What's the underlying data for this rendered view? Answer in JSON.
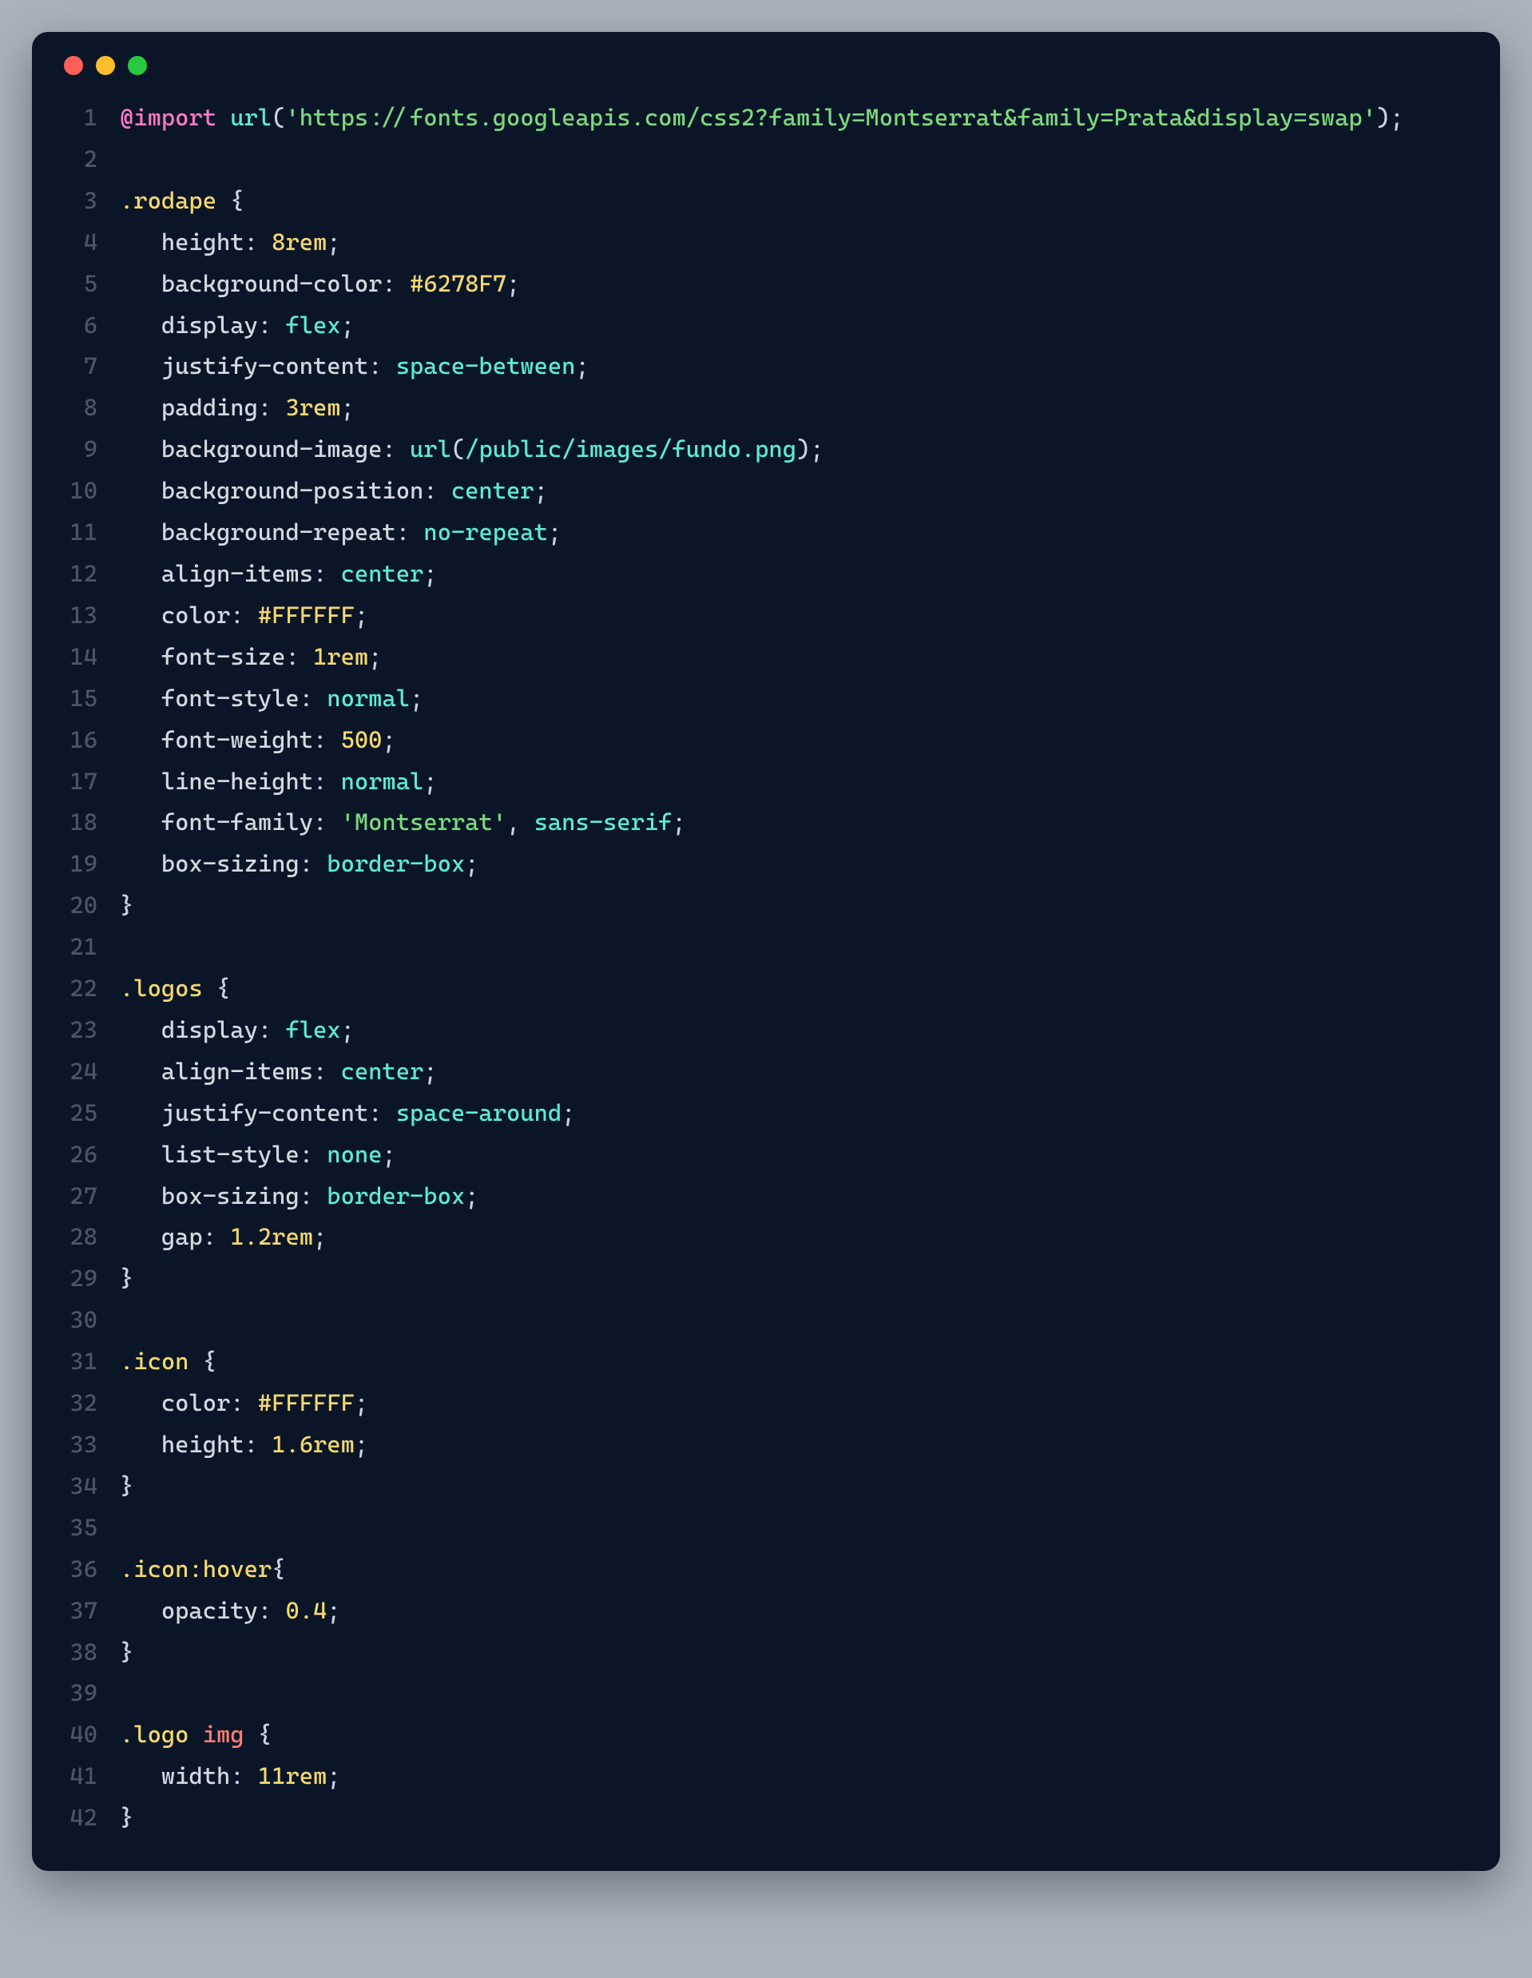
{
  "window": {
    "traffic_lights": [
      "red",
      "yellow",
      "green"
    ]
  },
  "code": {
    "lines": [
      {
        "n": 1,
        "t": [
          [
            "keyword",
            "@import"
          ],
          [
            "punc",
            " "
          ],
          [
            "func",
            "url"
          ],
          [
            "punc",
            "("
          ],
          [
            "string",
            "'https://fonts.googleapis.com/css2?family=Montserrat&family=Prata&display=swap'"
          ],
          [
            "punc",
            ");"
          ]
        ]
      },
      {
        "n": 2,
        "t": []
      },
      {
        "n": 3,
        "t": [
          [
            "selector",
            ".rodape"
          ],
          [
            "punc",
            " {"
          ]
        ]
      },
      {
        "n": 4,
        "t": [
          [
            "default",
            "   "
          ],
          [
            "prop",
            "height"
          ],
          [
            "punc",
            ": "
          ],
          [
            "number",
            "8rem"
          ],
          [
            "punc",
            ";"
          ]
        ]
      },
      {
        "n": 5,
        "t": [
          [
            "default",
            "   "
          ],
          [
            "prop",
            "background-color"
          ],
          [
            "punc",
            ": "
          ],
          [
            "number",
            "#6278F7"
          ],
          [
            "punc",
            ";"
          ]
        ]
      },
      {
        "n": 6,
        "t": [
          [
            "default",
            "   "
          ],
          [
            "prop",
            "display"
          ],
          [
            "punc",
            ": "
          ],
          [
            "value",
            "flex"
          ],
          [
            "punc",
            ";"
          ]
        ]
      },
      {
        "n": 7,
        "t": [
          [
            "default",
            "   "
          ],
          [
            "prop",
            "justify-content"
          ],
          [
            "punc",
            ": "
          ],
          [
            "value",
            "space-between"
          ],
          [
            "punc",
            ";"
          ]
        ]
      },
      {
        "n": 8,
        "t": [
          [
            "default",
            "   "
          ],
          [
            "prop",
            "padding"
          ],
          [
            "punc",
            ": "
          ],
          [
            "number",
            "3rem"
          ],
          [
            "punc",
            ";"
          ]
        ]
      },
      {
        "n": 9,
        "t": [
          [
            "default",
            "   "
          ],
          [
            "prop",
            "background-image"
          ],
          [
            "punc",
            ": "
          ],
          [
            "func",
            "url"
          ],
          [
            "punc",
            "("
          ],
          [
            "value",
            "/public/images/fundo.png"
          ],
          [
            "punc",
            ");"
          ]
        ]
      },
      {
        "n": 10,
        "t": [
          [
            "default",
            "   "
          ],
          [
            "prop",
            "background-position"
          ],
          [
            "punc",
            ": "
          ],
          [
            "value",
            "center"
          ],
          [
            "punc",
            ";"
          ]
        ]
      },
      {
        "n": 11,
        "t": [
          [
            "default",
            "   "
          ],
          [
            "prop",
            "background-repeat"
          ],
          [
            "punc",
            ": "
          ],
          [
            "value",
            "no-repeat"
          ],
          [
            "punc",
            ";"
          ]
        ]
      },
      {
        "n": 12,
        "t": [
          [
            "default",
            "   "
          ],
          [
            "prop",
            "align-items"
          ],
          [
            "punc",
            ": "
          ],
          [
            "value",
            "center"
          ],
          [
            "punc",
            ";"
          ]
        ]
      },
      {
        "n": 13,
        "t": [
          [
            "default",
            "   "
          ],
          [
            "prop",
            "color"
          ],
          [
            "punc",
            ": "
          ],
          [
            "number",
            "#FFFFFF"
          ],
          [
            "punc",
            ";"
          ]
        ]
      },
      {
        "n": 14,
        "t": [
          [
            "default",
            "   "
          ],
          [
            "prop",
            "font-size"
          ],
          [
            "punc",
            ": "
          ],
          [
            "number",
            "1rem"
          ],
          [
            "punc",
            ";"
          ]
        ]
      },
      {
        "n": 15,
        "t": [
          [
            "default",
            "   "
          ],
          [
            "prop",
            "font-style"
          ],
          [
            "punc",
            ": "
          ],
          [
            "value",
            "normal"
          ],
          [
            "punc",
            ";"
          ]
        ]
      },
      {
        "n": 16,
        "t": [
          [
            "default",
            "   "
          ],
          [
            "prop",
            "font-weight"
          ],
          [
            "punc",
            ": "
          ],
          [
            "number",
            "500"
          ],
          [
            "punc",
            ";"
          ]
        ]
      },
      {
        "n": 17,
        "t": [
          [
            "default",
            "   "
          ],
          [
            "prop",
            "line-height"
          ],
          [
            "punc",
            ": "
          ],
          [
            "value",
            "normal"
          ],
          [
            "punc",
            ";"
          ]
        ]
      },
      {
        "n": 18,
        "t": [
          [
            "default",
            "   "
          ],
          [
            "prop",
            "font-family"
          ],
          [
            "punc",
            ": "
          ],
          [
            "string",
            "'Montserrat'"
          ],
          [
            "punc",
            ", "
          ],
          [
            "value",
            "sans-serif"
          ],
          [
            "punc",
            ";"
          ]
        ]
      },
      {
        "n": 19,
        "t": [
          [
            "default",
            "   "
          ],
          [
            "prop",
            "box-sizing"
          ],
          [
            "punc",
            ": "
          ],
          [
            "value",
            "border-box"
          ],
          [
            "punc",
            ";"
          ]
        ]
      },
      {
        "n": 20,
        "t": [
          [
            "punc",
            "}"
          ]
        ]
      },
      {
        "n": 21,
        "t": []
      },
      {
        "n": 22,
        "t": [
          [
            "selector",
            ".logos"
          ],
          [
            "punc",
            " {"
          ]
        ]
      },
      {
        "n": 23,
        "t": [
          [
            "default",
            "   "
          ],
          [
            "prop",
            "display"
          ],
          [
            "punc",
            ": "
          ],
          [
            "value",
            "flex"
          ],
          [
            "punc",
            ";"
          ]
        ]
      },
      {
        "n": 24,
        "t": [
          [
            "default",
            "   "
          ],
          [
            "prop",
            "align-items"
          ],
          [
            "punc",
            ": "
          ],
          [
            "value",
            "center"
          ],
          [
            "punc",
            ";"
          ]
        ]
      },
      {
        "n": 25,
        "t": [
          [
            "default",
            "   "
          ],
          [
            "prop",
            "justify-content"
          ],
          [
            "punc",
            ": "
          ],
          [
            "value",
            "space-around"
          ],
          [
            "punc",
            ";"
          ]
        ]
      },
      {
        "n": 26,
        "t": [
          [
            "default",
            "   "
          ],
          [
            "prop",
            "list-style"
          ],
          [
            "punc",
            ": "
          ],
          [
            "value",
            "none"
          ],
          [
            "punc",
            ";"
          ]
        ]
      },
      {
        "n": 27,
        "t": [
          [
            "default",
            "   "
          ],
          [
            "prop",
            "box-sizing"
          ],
          [
            "punc",
            ": "
          ],
          [
            "value",
            "border-box"
          ],
          [
            "punc",
            ";"
          ]
        ]
      },
      {
        "n": 28,
        "t": [
          [
            "default",
            "   "
          ],
          [
            "prop",
            "gap"
          ],
          [
            "punc",
            ": "
          ],
          [
            "number",
            "1.2rem"
          ],
          [
            "punc",
            ";"
          ]
        ]
      },
      {
        "n": 29,
        "t": [
          [
            "punc",
            "}"
          ]
        ]
      },
      {
        "n": 30,
        "t": []
      },
      {
        "n": 31,
        "t": [
          [
            "selector",
            ".icon"
          ],
          [
            "punc",
            " {"
          ]
        ]
      },
      {
        "n": 32,
        "t": [
          [
            "default",
            "   "
          ],
          [
            "prop",
            "color"
          ],
          [
            "punc",
            ": "
          ],
          [
            "number",
            "#FFFFFF"
          ],
          [
            "punc",
            ";"
          ]
        ]
      },
      {
        "n": 33,
        "t": [
          [
            "default",
            "   "
          ],
          [
            "prop",
            "height"
          ],
          [
            "punc",
            ": "
          ],
          [
            "number",
            "1.6rem"
          ],
          [
            "punc",
            ";"
          ]
        ]
      },
      {
        "n": 34,
        "t": [
          [
            "punc",
            "}"
          ]
        ]
      },
      {
        "n": 35,
        "t": []
      },
      {
        "n": 36,
        "t": [
          [
            "selector",
            ".icon:hover"
          ],
          [
            "punc",
            "{"
          ]
        ]
      },
      {
        "n": 37,
        "t": [
          [
            "default",
            "   "
          ],
          [
            "prop",
            "opacity"
          ],
          [
            "punc",
            ": "
          ],
          [
            "number",
            "0.4"
          ],
          [
            "punc",
            ";"
          ]
        ]
      },
      {
        "n": 38,
        "t": [
          [
            "punc",
            "}"
          ]
        ]
      },
      {
        "n": 39,
        "t": []
      },
      {
        "n": 40,
        "t": [
          [
            "selector",
            ".logo"
          ],
          [
            "punc",
            " "
          ],
          [
            "tag",
            "img"
          ],
          [
            "punc",
            " {"
          ]
        ]
      },
      {
        "n": 41,
        "t": [
          [
            "default",
            "   "
          ],
          [
            "prop",
            "width"
          ],
          [
            "punc",
            ": "
          ],
          [
            "number",
            "11rem"
          ],
          [
            "punc",
            ";"
          ]
        ]
      },
      {
        "n": 42,
        "t": [
          [
            "punc",
            "}"
          ]
        ]
      }
    ]
  }
}
